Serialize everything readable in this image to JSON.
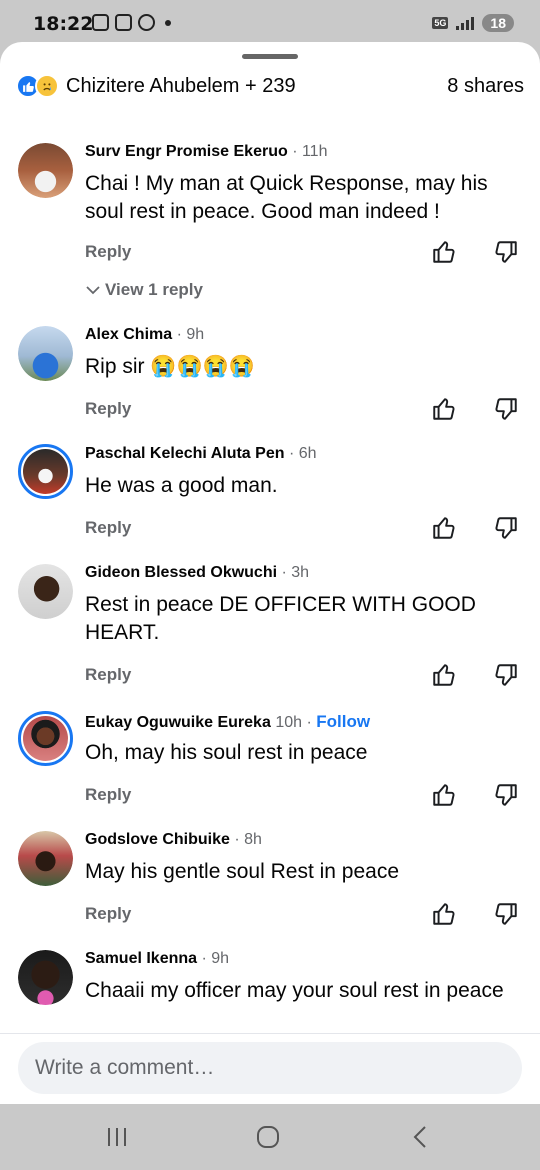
{
  "status_bar": {
    "time": "18:22",
    "network": "5G",
    "battery": "18"
  },
  "header": {
    "reactors": "Chizitere Ahubelem + 239",
    "shares": "8 shares",
    "reaction_icons": [
      "like-icon",
      "sad-icon"
    ]
  },
  "comments": [
    {
      "name": "Surv Engr Promise Ekeruo",
      "time": "· 11h",
      "text": "Chai ! My man at Quick Response, may his soul rest in peace. Good man indeed !",
      "reply": "Reply",
      "view_replies": "View 1 reply"
    },
    {
      "name": "Alex Chima",
      "time": "· 9h",
      "text": "Rip sir 😭😭😭😭",
      "reply": "Reply"
    },
    {
      "name": "Paschal Kelechi Aluta Pen",
      "time": "· 6h",
      "text": "He was a good man.",
      "reply": "Reply"
    },
    {
      "name": "Gideon Blessed Okwuchi",
      "time": "· 3h",
      "text": "Rest in peace DE OFFICER WITH GOOD HEART.",
      "reply": "Reply"
    },
    {
      "name": "Eukay Oguwuike Eureka",
      "time": "10h ·",
      "follow": "Follow",
      "text": "Oh, may his soul rest in peace",
      "reply": "Reply"
    },
    {
      "name": "Godslove Chibuike",
      "time": "· 8h",
      "text": "May his gentle soul Rest in peace",
      "reply": "Reply"
    },
    {
      "name": "Samuel Ikenna",
      "time": "· 9h",
      "text": "Chaaii my officer may your soul rest in peace"
    }
  ],
  "composer": {
    "placeholder": "Write a comment…"
  },
  "colors": {
    "accent": "#1877f2",
    "secondary_text": "#65676b"
  }
}
